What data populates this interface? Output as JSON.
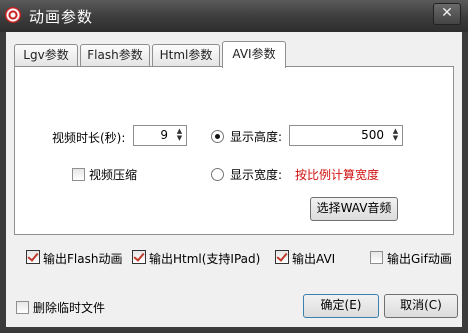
{
  "window": {
    "title": "动画参数",
    "close_glyph": "✕"
  },
  "tabs": [
    {
      "label": "Lgv参数",
      "active": false
    },
    {
      "label": "Flash参数",
      "active": false
    },
    {
      "label": "Html参数",
      "active": false
    },
    {
      "label": "AVI参数",
      "active": true
    }
  ],
  "avi": {
    "duration_label": "视频时长(秒):",
    "duration_value": "9",
    "compress_label": "视频压缩",
    "compress_checked": false,
    "height_radio_label": "显示高度:",
    "height_value": "500",
    "width_radio_label": "显示宽度:",
    "width_note": "按比例计算宽度",
    "wav_button": "选择WAV音频"
  },
  "outputs": [
    {
      "label": "输出Flash动画",
      "checked": true
    },
    {
      "label": "输出Html(支持IPad)",
      "checked": true
    },
    {
      "label": "输出AVI",
      "checked": true
    },
    {
      "label": "输出Gif动画",
      "checked": false
    }
  ],
  "footer": {
    "delete_temp_label": "删除临时文件",
    "ok_button": "确定(E)",
    "cancel_button": "取消(C)"
  },
  "colors": {
    "note_red": "#d01010",
    "check_red": "#c0392b"
  }
}
